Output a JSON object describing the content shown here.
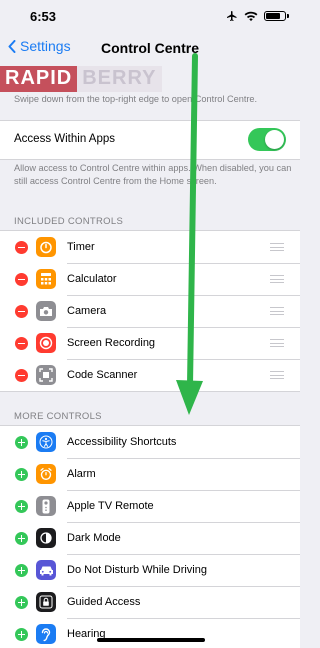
{
  "status": {
    "time": "6:53"
  },
  "nav": {
    "back_label": "Settings",
    "title": "Control Centre"
  },
  "watermark": {
    "part1": "RAPID",
    "part2": "BERRY"
  },
  "intro_text": "Swipe down from the top-right edge to open Control Centre.",
  "access": {
    "label": "Access Within Apps",
    "on": true,
    "note": "Allow access to Control Centre within apps. When disabled, you can still access Control Centre from the Home screen."
  },
  "included": {
    "header": "INCLUDED CONTROLS",
    "items": [
      {
        "label": "Timer",
        "icon": "timer-icon",
        "color": "#ff9500"
      },
      {
        "label": "Calculator",
        "icon": "calculator-icon",
        "color": "#ff9500"
      },
      {
        "label": "Camera",
        "icon": "camera-icon",
        "color": "#8e8e93"
      },
      {
        "label": "Screen Recording",
        "icon": "screen-recording-icon",
        "color": "#ff3b30"
      },
      {
        "label": "Code Scanner",
        "icon": "code-scanner-icon",
        "color": "#8e8e93"
      }
    ]
  },
  "more": {
    "header": "MORE CONTROLS",
    "items": [
      {
        "label": "Accessibility Shortcuts",
        "icon": "accessibility-icon",
        "color": "#1b7cf3"
      },
      {
        "label": "Alarm",
        "icon": "alarm-icon",
        "color": "#ff9500"
      },
      {
        "label": "Apple TV Remote",
        "icon": "remote-icon",
        "color": "#8e8e93"
      },
      {
        "label": "Dark Mode",
        "icon": "dark-mode-icon",
        "color": "#1c1c1e"
      },
      {
        "label": "Do Not Disturb While Driving",
        "icon": "car-icon",
        "color": "#5856d6"
      },
      {
        "label": "Guided Access",
        "icon": "lock-icon",
        "color": "#1c1c1e"
      },
      {
        "label": "Hearing",
        "icon": "ear-icon",
        "color": "#1b7cf3"
      }
    ]
  },
  "colors": {
    "accent": "#1b7cf3",
    "toggle_on": "#34c759",
    "remove": "#ff3b30",
    "add": "#34c759",
    "arrow": "#2fb54a"
  }
}
